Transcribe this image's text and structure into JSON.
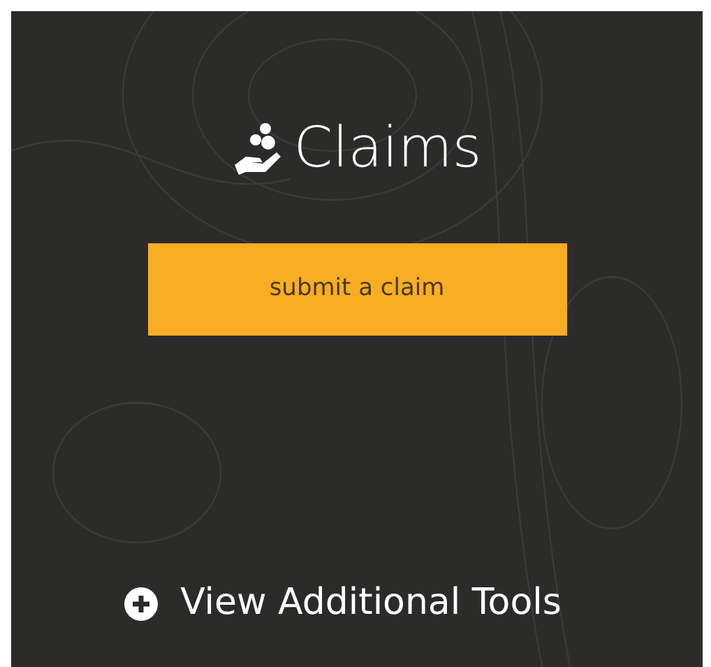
{
  "panel": {
    "title": "Claims",
    "button": "submit a claim",
    "link": "View Additional Tools"
  }
}
